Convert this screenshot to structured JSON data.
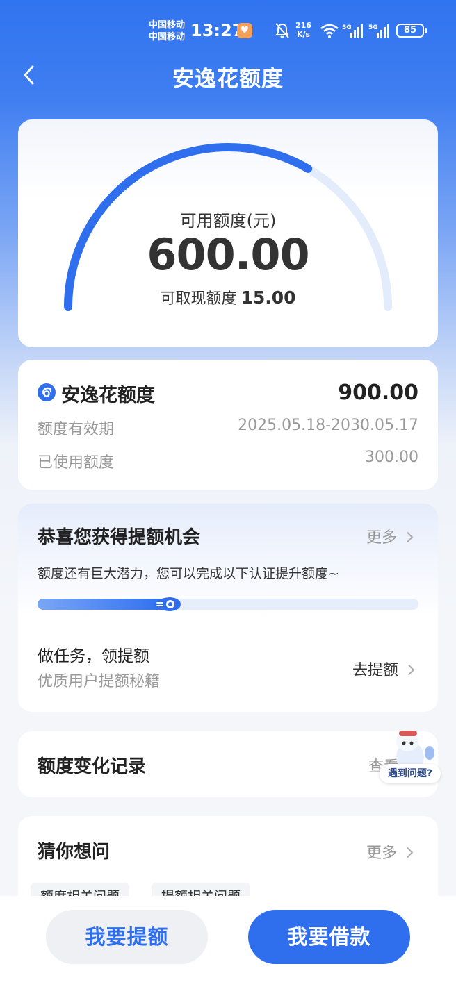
{
  "status_bar": {
    "carrier_1": "中国移动",
    "carrier_2": "中国移动",
    "time": "13:27",
    "net_speed_value": "216",
    "net_speed_unit": "K/s",
    "signal_1": "5G",
    "signal_2": "5G",
    "battery": "85"
  },
  "header": {
    "title": "安逸花额度"
  },
  "gauge": {
    "label": "可用额度(元)",
    "amount": "600.00",
    "cash_label": "可取现额度",
    "cash_value": "15.00",
    "fill_fraction": 0.667,
    "color_active": "#2f6fee",
    "color_track": "#e3ecfb"
  },
  "credit_info": {
    "title": "安逸花额度",
    "total": "900.00",
    "validity_label": "额度有效期",
    "validity_value": "2025.05.18-2030.05.17",
    "used_label": "已使用额度",
    "used_value": "300.00"
  },
  "raise_card": {
    "title": "恭喜您获得提额机会",
    "more_label": "更多",
    "subtitle": "额度还有巨大潜力，您可以完成以下认证提升额度~",
    "progress_fraction": 0.34,
    "task_title": "做任务，领提额",
    "task_subtitle": "优质用户提额秘籍",
    "task_action": "去提额"
  },
  "record_card": {
    "title": "额度变化记录",
    "view_label": "查看"
  },
  "faq_card": {
    "title": "猜你想问",
    "more_label": "更多",
    "tags": [
      "额度相关问题",
      "提额相关问题"
    ]
  },
  "helper": {
    "bubble_label": "遇到问题?"
  },
  "bottom_bar": {
    "raise_button": "我要提额",
    "borrow_button": "我要借款"
  }
}
